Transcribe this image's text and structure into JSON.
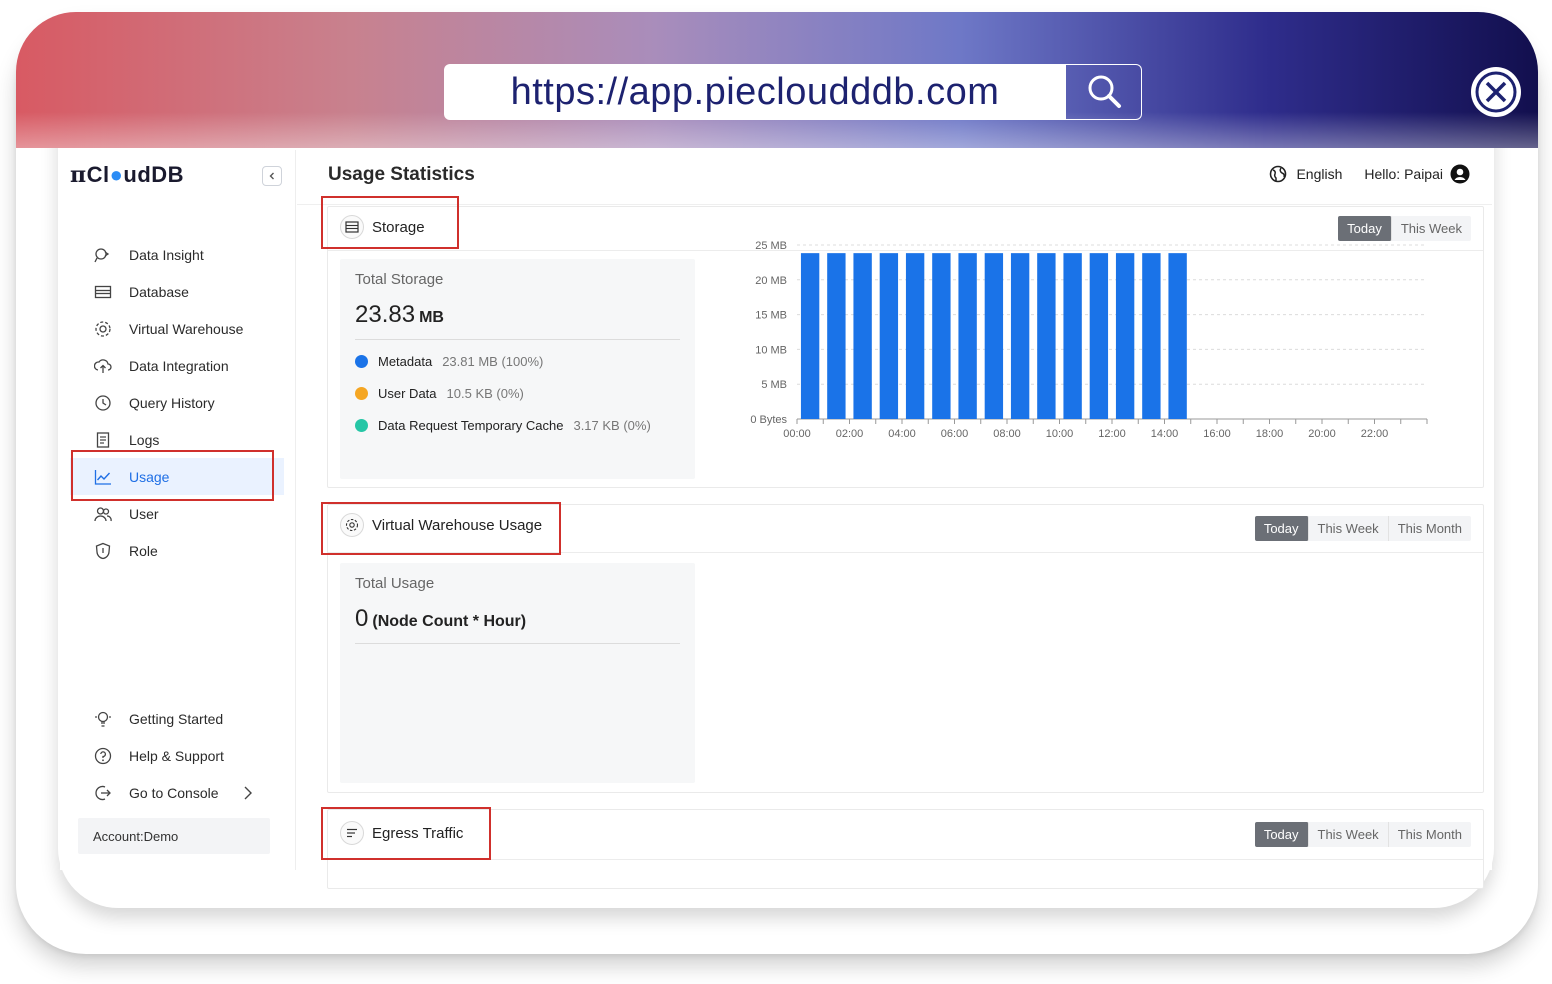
{
  "browser": {
    "url": "https://app.piecloudddb.com"
  },
  "sidebar": {
    "logo_prefix": "π",
    "logo_text_a": "Cl",
    "logo_text_b": "udDB",
    "items": [
      {
        "label": "Data Insight",
        "icon": "data-insight-icon"
      },
      {
        "label": "Database",
        "icon": "database-icon"
      },
      {
        "label": "Virtual Warehouse",
        "icon": "warehouse-icon"
      },
      {
        "label": "Data Integration",
        "icon": "cloud-upload-icon"
      },
      {
        "label": "Query History",
        "icon": "history-icon"
      },
      {
        "label": "Logs",
        "icon": "logs-icon"
      },
      {
        "label": "Usage",
        "icon": "usage-chart-icon",
        "active": true
      },
      {
        "label": "User",
        "icon": "users-icon"
      },
      {
        "label": "Role",
        "icon": "shield-icon"
      }
    ],
    "bottom_items": [
      {
        "label": "Getting Started",
        "icon": "bulb-icon"
      },
      {
        "label": "Help & Support",
        "icon": "help-icon"
      },
      {
        "label": "Go to Console",
        "icon": "exit-icon"
      }
    ],
    "account": "Account:Demo"
  },
  "header": {
    "title": "Usage Statistics",
    "language": "English",
    "greeting": "Hello: Paipai"
  },
  "storage": {
    "title": "Storage",
    "tabs": [
      "Today",
      "This Week"
    ],
    "active_tab": "Today",
    "total_label": "Total Storage",
    "total_value": "23.83",
    "total_unit": "MB",
    "legend": [
      {
        "name": "Metadata",
        "value": "23.81 MB (100%)",
        "color": "#1a73e8"
      },
      {
        "name": "User Data",
        "value": "10.5 KB (0%)",
        "color": "#f5a623"
      },
      {
        "name": "Data Request Temporary Cache",
        "value": "3.17 KB (0%)",
        "color": "#26c6a6"
      }
    ]
  },
  "warehouse": {
    "title": "Virtual Warehouse Usage",
    "tabs": [
      "Today",
      "This Week",
      "This Month"
    ],
    "active_tab": "Today",
    "total_label": "Total Usage",
    "total_value": "0",
    "total_unit": "(Node Count * Hour)"
  },
  "egress": {
    "title": "Egress Traffic",
    "tabs": [
      "Today",
      "This Week",
      "This Month"
    ],
    "active_tab": "Today"
  },
  "chart_data": {
    "type": "bar",
    "title": "",
    "xlabel": "",
    "ylabel": "",
    "y_tick_labels": [
      "0 Bytes",
      "5 MB",
      "10 MB",
      "15 MB",
      "20 MB",
      "25 MB"
    ],
    "y_ticks_mb": [
      0,
      5,
      10,
      15,
      20,
      25
    ],
    "ylim": [
      0,
      25
    ],
    "x_tick_labels": [
      "00:00",
      "02:00",
      "04:00",
      "06:00",
      "08:00",
      "10:00",
      "12:00",
      "14:00",
      "16:00",
      "18:00",
      "20:00",
      "22:00"
    ],
    "hours": [
      0,
      1,
      2,
      3,
      4,
      5,
      6,
      7,
      8,
      9,
      10,
      11,
      12,
      13,
      14,
      15,
      16,
      17,
      18,
      19,
      20,
      21,
      22,
      23
    ],
    "values_mb": [
      23.83,
      23.83,
      23.83,
      23.83,
      23.83,
      23.83,
      23.83,
      23.83,
      23.83,
      23.83,
      23.83,
      23.83,
      23.83,
      23.83,
      23.83,
      null,
      null,
      null,
      null,
      null,
      null,
      null,
      null,
      null
    ],
    "bar_color": "#1a73e8",
    "grid": true
  }
}
